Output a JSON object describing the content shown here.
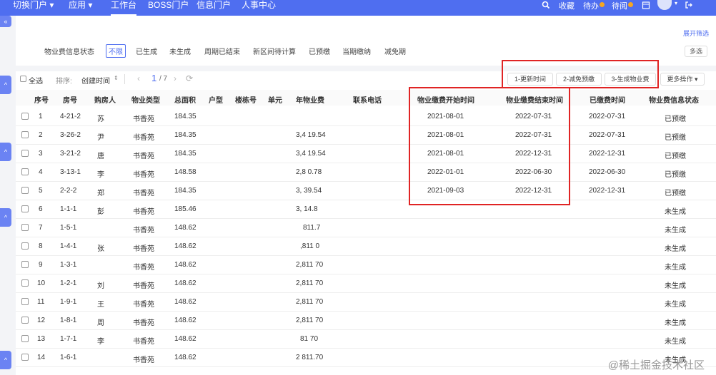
{
  "topnav": {
    "items": [
      {
        "label": "切换门户 ▾"
      },
      {
        "label": "应用 ▾"
      },
      {
        "label": "工作台"
      },
      {
        "label": "BOSS门户"
      },
      {
        "label": "信息门户"
      },
      {
        "label": "人事中心"
      }
    ],
    "right": {
      "favorites": "收藏",
      "todo": "待办",
      "unread": "待阅"
    }
  },
  "filters": {
    "label": "物业费信息状态",
    "options": [
      "不限",
      "已生成",
      "未生成",
      "周期已结束",
      "新区间待计算",
      "已预缴",
      "当期缴纳",
      "减免期"
    ],
    "expand": "展开筛选",
    "multi": "多选"
  },
  "toolbar": {
    "select_all": "全选",
    "sort_label": "排序:",
    "sort_value": "创建时间",
    "page_current": "1",
    "page_total": "/ 7",
    "btn_update": "1-更新时间",
    "btn_reduce": "2-减免预缴",
    "btn_generate": "3-生成物业费",
    "btn_more": "更多操作 ▾"
  },
  "table": {
    "headers": [
      "序号",
      "房号",
      "购房人",
      "物业类型",
      "总面积",
      "户型",
      "楼栋号",
      "单元",
      "年物业费",
      "联系电话",
      "物业缴费开始时间",
      "物业缴费结束时间",
      "已缴费时间",
      "物业费信息状态"
    ],
    "rows": [
      {
        "no": "1",
        "room": "4-21-2",
        "buyer": "苏",
        "type": "书香苑",
        "area": "184.35",
        "fee": "",
        "phone": "",
        "start": "2021-08-01",
        "end": "2022-07-31",
        "paid": "2022-07-31",
        "status": "已预缴"
      },
      {
        "no": "2",
        "room": "3-26-2",
        "buyer": "尹",
        "type": "书香苑",
        "area": "184.35",
        "fee": "3,4 19.54",
        "phone": "",
        "start": "2021-08-01",
        "end": "2022-07-31",
        "paid": "2022-07-31",
        "status": "已预缴"
      },
      {
        "no": "3",
        "room": "3-21-2",
        "buyer": "唐",
        "type": "书香苑",
        "area": "184.35",
        "fee": "3,4 19.54",
        "phone": "",
        "start": "2021-08-01",
        "end": "2022-12-31",
        "paid": "2022-12-31",
        "status": "已预缴"
      },
      {
        "no": "4",
        "room": "3-13-1",
        "buyer": "李",
        "type": "书香苑",
        "area": "148.58",
        "fee": "2,8 0.78",
        "phone": "",
        "start": "2022-01-01",
        "end": "2022-06-30",
        "paid": "2022-06-30",
        "status": "已预缴"
      },
      {
        "no": "5",
        "room": "2-2-2",
        "buyer": "郑",
        "type": "书香苑",
        "area": "184.35",
        "fee": "3, 39.54",
        "phone": "",
        "start": "2021-09-03",
        "end": "2022-12-31",
        "paid": "2022-12-31",
        "status": "已预缴"
      },
      {
        "no": "6",
        "room": "1-1-1",
        "buyer": "彭",
        "type": "书香苑",
        "area": "185.46",
        "fee": "3, 14.8",
        "phone": "",
        "start": "",
        "end": "",
        "paid": "",
        "status": "未生成"
      },
      {
        "no": "7",
        "room": "1-5-1",
        "buyer": "",
        "type": "书香苑",
        "area": "148.62",
        "fee": "811.7",
        "phone": "",
        "start": "",
        "end": "",
        "paid": "",
        "status": "未生成"
      },
      {
        "no": "8",
        "room": "1-4-1",
        "buyer": "张",
        "type": "书香苑",
        "area": "148.62",
        "fee": ",811 0",
        "phone": "",
        "start": "",
        "end": "",
        "paid": "",
        "status": "未生成"
      },
      {
        "no": "9",
        "room": "1-3-1",
        "buyer": "",
        "type": "书香苑",
        "area": "148.62",
        "fee": "2,811 70",
        "phone": "",
        "start": "",
        "end": "",
        "paid": "",
        "status": "未生成"
      },
      {
        "no": "10",
        "room": "1-2-1",
        "buyer": "刘",
        "type": "书香苑",
        "area": "148.62",
        "fee": "2,811 70",
        "phone": "",
        "start": "",
        "end": "",
        "paid": "",
        "status": "未生成"
      },
      {
        "no": "11",
        "room": "1-9-1",
        "buyer": "王",
        "type": "书香苑",
        "area": "148.62",
        "fee": "2,811 70",
        "phone": "",
        "start": "",
        "end": "",
        "paid": "",
        "status": "未生成"
      },
      {
        "no": "12",
        "room": "1-8-1",
        "buyer": "周",
        "type": "书香苑",
        "area": "148.62",
        "fee": "2,811 70",
        "phone": "",
        "start": "",
        "end": "",
        "paid": "",
        "status": "未生成"
      },
      {
        "no": "13",
        "room": "1-7-1",
        "buyer": "李",
        "type": "书香苑",
        "area": "148.62",
        "fee": "81 70",
        "phone": "",
        "start": "",
        "end": "",
        "paid": "",
        "status": "未生成"
      },
      {
        "no": "14",
        "room": "1-6-1",
        "buyer": "",
        "type": "书香苑",
        "area": "148.62",
        "fee": "2 811.70",
        "phone": "",
        "start": "",
        "end": "",
        "paid": "",
        "status": "未生成"
      }
    ]
  },
  "watermark": "@稀土掘金技术社区",
  "colors": {
    "brand": "#4f6ef0",
    "highlight": "#e02424"
  }
}
